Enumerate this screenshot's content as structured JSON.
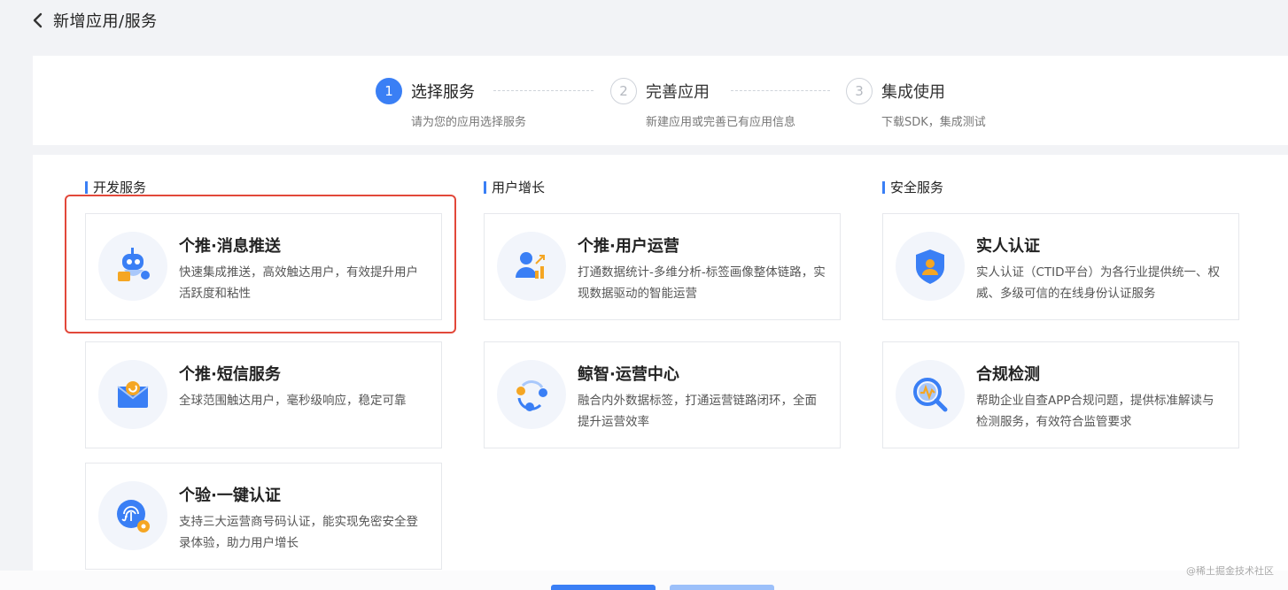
{
  "header": {
    "title": "新增应用/服务"
  },
  "steps": [
    {
      "num": "1",
      "label": "选择服务",
      "desc": "请为您的应用选择服务",
      "state": "active"
    },
    {
      "num": "2",
      "label": "完善应用",
      "desc": "新建应用或完善已有应用信息",
      "state": "pending"
    },
    {
      "num": "3",
      "label": "集成使用",
      "desc": "下载SDK，集成测试",
      "state": "pending"
    }
  ],
  "categories": [
    {
      "name": "开发服务",
      "cards": [
        {
          "title": "个推·消息推送",
          "desc": "快速集成推送，高效触达用户，有效提升用户活跃度和粘性",
          "icon": "push-robot-icon",
          "selected": true
        },
        {
          "title": "个推·短信服务",
          "desc": "全球范围触达用户，毫秒级响应，稳定可靠",
          "icon": "sms-envelope-icon"
        },
        {
          "title": "个验·一键认证",
          "desc": "支持三大运营商号码认证，能实现免密安全登录体验，助力用户增长",
          "icon": "fingerprint-icon"
        }
      ]
    },
    {
      "name": "用户增长",
      "cards": [
        {
          "title": "个推·用户运营",
          "desc": "打通数据统计-多维分析-标签画像整体链路，实现数据驱动的智能运营",
          "icon": "user-growth-icon"
        },
        {
          "title": "鲸智·运营中心",
          "desc": "融合内外数据标签，打通运营链路闭环，全面提升运营效率",
          "icon": "operation-loop-icon"
        }
      ]
    },
    {
      "name": "安全服务",
      "cards": [
        {
          "title": "实人认证",
          "desc": "实人认证（CTID平台）为各行业提供统一、权威、多级可信的在线身份认证服务",
          "icon": "identity-shield-icon"
        },
        {
          "title": "合规检测",
          "desc": "帮助企业自查APP合规问题，提供标准解读与检测服务，有效符合监管要求",
          "icon": "compliance-search-icon"
        }
      ]
    }
  ],
  "watermark": "@稀土掘金技术社区",
  "colors": {
    "accent": "#3a7ff5",
    "highlight": "#e2483a",
    "icon_orange": "#f5a623"
  }
}
